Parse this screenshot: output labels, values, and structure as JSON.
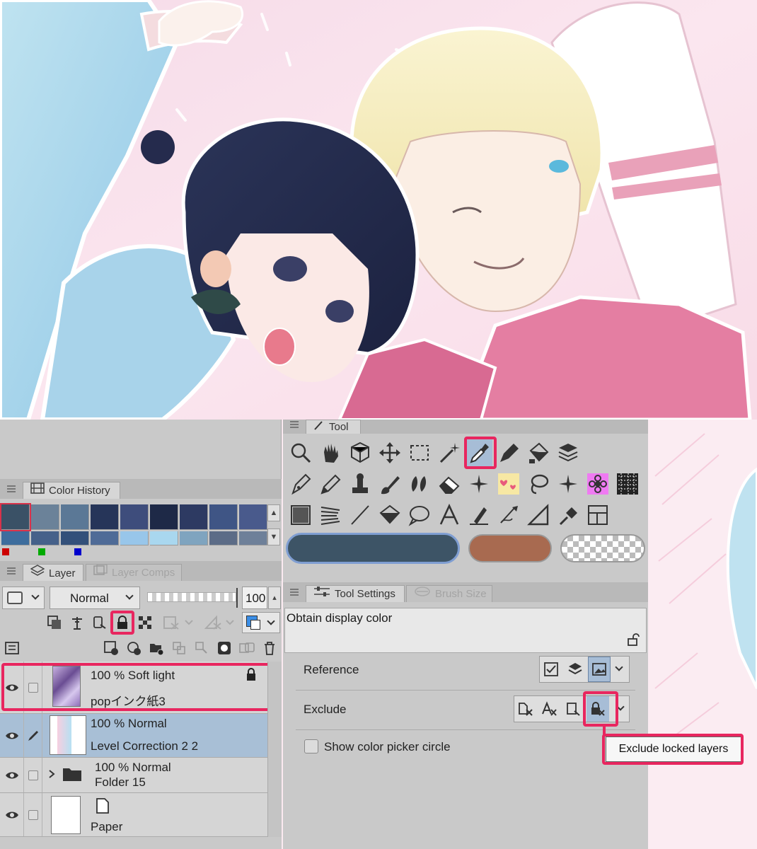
{
  "tool_panel": {
    "tab_label": "Tool"
  },
  "color_history": {
    "tab_label": "Color History",
    "swatches_row1": [
      "#3a5166",
      "#6b8299",
      "#5b7896",
      "#263559",
      "#3e4d7c",
      "#1e2947",
      "#2d3a62",
      "#3f5585",
      "#495a8c"
    ],
    "swatches_row2": [
      "#3e6d9d",
      "#46618a",
      "#33507a",
      "#4f6b97",
      "#98c6ea",
      "#a9d7ef",
      "#7fa4bf",
      "#5c6c87",
      "#6e8099"
    ],
    "indicator_colors": [
      "#cc0000",
      "#00aa00",
      "#0000cc"
    ]
  },
  "layer_panel": {
    "tabs": [
      "Layer",
      "Layer Comps"
    ],
    "blend_mode": "Normal",
    "opacity": "100",
    "layers": [
      {
        "blend": "100 % Soft light",
        "name": "popインク紙3",
        "locked": true
      },
      {
        "blend": "100 % Normal",
        "name": "Level Correction 2 2",
        "selected": true
      },
      {
        "blend": "100 % Normal",
        "name": "Folder 15",
        "folder": true
      },
      {
        "blend": "",
        "name": "Paper"
      }
    ]
  },
  "colors": {
    "main": "#3d5466",
    "sub": "#a86a50",
    "accent_highlight": "#e8265f"
  },
  "tool_settings": {
    "tabs": [
      "Tool Settings",
      "Brush Size"
    ],
    "subtool_name": "Obtain display color",
    "reference_label": "Reference",
    "exclude_label": "Exclude",
    "show_circle_label": "Show color picker circle",
    "tooltip": "Exclude locked layers"
  }
}
